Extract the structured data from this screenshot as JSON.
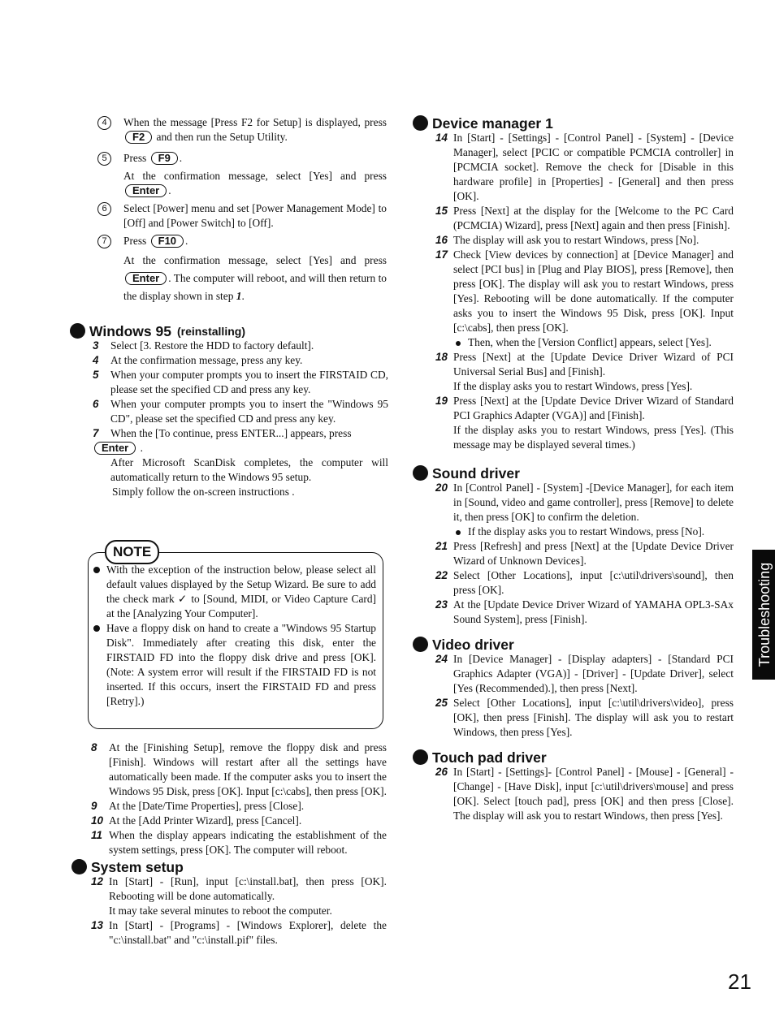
{
  "setup_steps": [
    {
      "marker": "4",
      "parts": [
        "When the message [Press F2 for Setup] is displayed, press ",
        "F2",
        " and then run the Setup Utility."
      ]
    },
    {
      "marker": "5",
      "parts": [
        "Press ",
        "F9",
        "."
      ],
      "extra": [
        "At the confirmation message, select [Yes] and press ",
        "Enter",
        "."
      ]
    },
    {
      "marker": "6",
      "parts": [
        "Select [Power] menu and set [Power Management Mode] to [Off] and [Power Switch] to [Off]."
      ]
    },
    {
      "marker": "7",
      "parts": [
        "Press ",
        "F10",
        "."
      ],
      "extra": [
        "At the confirmation message, select [Yes] and press ",
        "Enter",
        ". The computer will reboot, and will then return to the display shown in step ",
        "1",
        "."
      ]
    }
  ],
  "windows95": {
    "heading": "Windows 95",
    "subheading": "(reinstalling)",
    "steps": [
      {
        "num": "3",
        "text": "Select [3. Restore the HDD to factory default]."
      },
      {
        "num": "4",
        "text": "At the confirmation message, press any key."
      },
      {
        "num": "5",
        "text": "When your computer prompts you to insert the FIRSTAID CD, please set the specified CD and press any key."
      },
      {
        "num": "6",
        "text": "When your computer prompts you to insert the \"Windows 95 CD\", please set the specified CD and press any key."
      },
      {
        "num": "7",
        "text": "When the [To continue, press ENTER...] appears, press",
        "key": "Enter",
        "after": "After Microsoft ScanDisk completes, the computer will automatically return to the Windows 95 setup.",
        "after2": "Simply follow the on-screen instructions ."
      }
    ]
  },
  "note": {
    "badge": "NOTE",
    "items": [
      "With the exception of the instruction below, please select all default values displayed by the Setup Wizard. Be sure to add the check mark ✓ to [Sound, MIDI, or Video Capture Card] at the [Analyzing Your Computer].",
      "Have a floppy disk on hand to create a \"Windows 95 Startup Disk\". Immediately after creating this disk, enter the FIRSTAID FD into the floppy disk drive and press [OK]. (Note: A system error will result if the FIRSTAID FD is not inserted. If this occurs, insert the FIRSTAID FD and press [Retry].)"
    ]
  },
  "windows95_cont": [
    {
      "num": "8",
      "text": "At the [Finishing Setup], remove the floppy disk and press [Finish]. Windows will restart after all the settings have automatically been made. If the computer asks you to insert the Windows 95 Disk, press [OK]. Input [c:\\cabs], then press [OK]."
    },
    {
      "num": "9",
      "text": "At the [Date/Time Properties], press [Close]."
    },
    {
      "num": "10",
      "text": "At the [Add Printer Wizard], press [Cancel]."
    },
    {
      "num": "11",
      "text": "When the display appears indicating the establishment of the system settings, press [OK]. The computer will reboot."
    }
  ],
  "system_setup": {
    "heading": "System setup",
    "steps": [
      {
        "num": "12",
        "text": "In [Start] - [Run], input [c:\\install.bat], then press [OK]. Rebooting will be done automatically.",
        "after": "It may take several minutes to reboot the computer."
      },
      {
        "num": "13",
        "text": "In [Start] - [Programs] - [Windows Explorer], delete the \"c:\\install.bat\" and \"c:\\install.pif\" files."
      }
    ]
  },
  "device_manager": {
    "heading": "Device manager 1",
    "steps": [
      {
        "num": "14",
        "text": "In [Start] - [Settings] - [Control Panel] - [System] - [Device Manager], select [PCIC or compatible PCMCIA controller] in [PCMCIA socket]. Remove the check for [Disable in this hardware profile] in [Properties] - [General] and then press [OK]."
      },
      {
        "num": "15",
        "text": "Press [Next] at the display for the [Welcome to the PC Card (PCMCIA) Wizard], press [Next] again and then press [Finish]."
      },
      {
        "num": "16",
        "text": "The display will ask you to restart Windows, press [No]."
      },
      {
        "num": "17",
        "text": "Check [View devices by connection] at [Device Manager] and select [PCI bus] in [Plug and Play BIOS], press [Remove], then press [OK]. The display will ask you to restart Windows, press [Yes]. Rebooting will be done automatically. If the computer asks you to insert the Windows 95 Disk, press [OK]. Input [c:\\cabs], then press [OK].",
        "bullet": "Then, when the [Version Conflict] appears, select [Yes]."
      },
      {
        "num": "18",
        "text": "Press [Next] at the [Update Device Driver Wizard of PCI Universal Serial Bus] and [Finish].",
        "after": "If the display asks you to restart Windows, press [Yes]."
      },
      {
        "num": "19",
        "text": "Press [Next] at the [Update Device Driver Wizard of Standard PCI Graphics Adapter (VGA)] and [Finish].",
        "after": "If the display asks you to restart Windows, press [Yes]. (This message may be displayed several times.)"
      }
    ]
  },
  "sound_driver": {
    "heading": "Sound driver",
    "steps": [
      {
        "num": "20",
        "text": "In [Control Panel] - [System] -[Device Manager], for each item in [Sound, video and game controller], press [Remove] to delete it, then press [OK] to confirm the deletion.",
        "bullet": "If the display asks you to restart Windows, press [No]."
      },
      {
        "num": "21",
        "text": "Press [Refresh] and press [Next] at the [Update Device Driver Wizard of Unknown Devices]."
      },
      {
        "num": "22",
        "text": "Select [Other Locations], input [c:\\util\\drivers\\sound], then press [OK]."
      },
      {
        "num": "23",
        "text": "At the [Update Device Driver Wizard of YAMAHA OPL3-SAx Sound System], press [Finish]."
      }
    ]
  },
  "video_driver": {
    "heading": "Video driver",
    "steps": [
      {
        "num": "24",
        "text": "In [Device Manager] - [Display adapters] - [Standard PCI Graphics Adapter (VGA)] - [Driver] - [Update Driver], select [Yes (Recommended).], then press [Next]."
      },
      {
        "num": "25",
        "text": "Select [Other Locations], input [c:\\util\\drivers\\video], press [OK], then press [Finish]. The display will ask you to restart Windows, then press [Yes]."
      }
    ]
  },
  "touch_pad_driver": {
    "heading": "Touch pad driver",
    "steps": [
      {
        "num": "26",
        "text": "In [Start] - [Settings]- [Control Panel] - [Mouse] - [General] - [Change] - [Have Disk], input [c:\\util\\drivers\\mouse] and press [OK]. Select [touch pad], press [OK] and then press [Close]. The display will ask you to restart Windows, then press [Yes]."
      }
    ]
  },
  "side_tab": "Troubleshooting",
  "page_number": "21"
}
